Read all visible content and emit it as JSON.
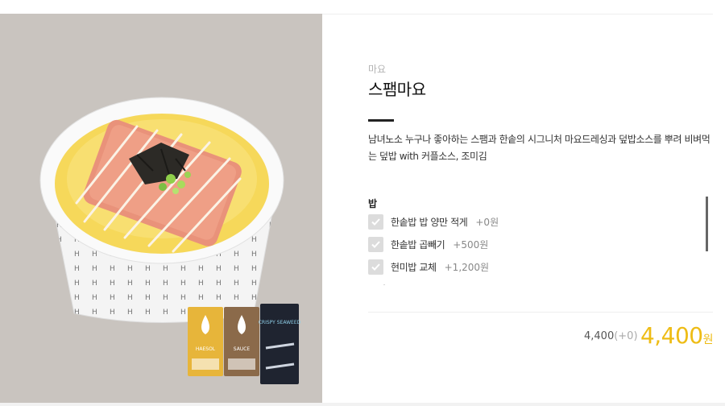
{
  "product": {
    "category": "마요",
    "name": "스팸마요",
    "description": "남녀노소 누구나 좋아하는 스팸과 한솥의 시그니처 마요드레싱과 덮밥소스를 뿌려 비벼먹는 덮밥 with 커플소스, 조미김",
    "image_alt": "스팸마요 덮밥"
  },
  "options": {
    "heading": "밥",
    "items": [
      {
        "name": "한솥밥 밥 양만 적게",
        "price": "+0원"
      },
      {
        "name": "한솥밥 곱빼기",
        "price": "+500원"
      },
      {
        "name": "현미밥 교체",
        "price": "+1,200원"
      }
    ],
    "next_heading_partial": "토핑"
  },
  "pricing": {
    "base": "4,400",
    "extra": "(+0)",
    "total": "4,400",
    "currency": "원"
  },
  "package_text": {
    "sauce1": "HAESOL",
    "sauce2": "SAUCE",
    "seaweed": "CRISPY SEAWEED"
  },
  "colors": {
    "accent": "#eebc15",
    "image_bg": "#c9c4bf",
    "rice": "#f6d85a"
  }
}
